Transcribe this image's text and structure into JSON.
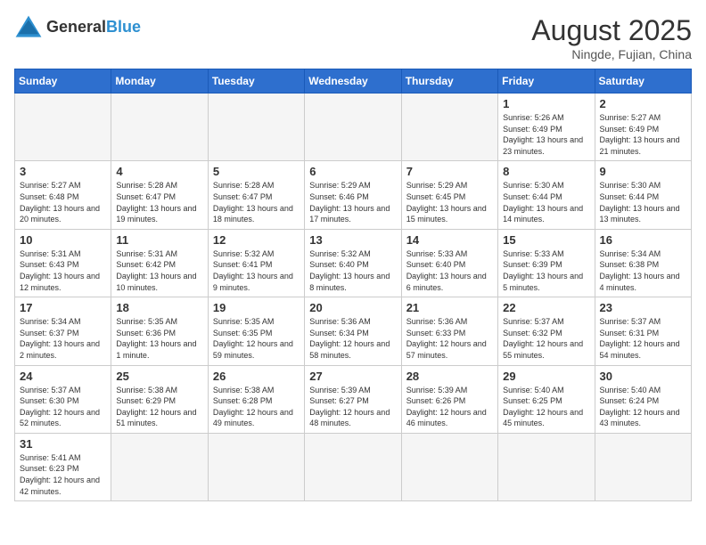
{
  "logo": {
    "text_general": "General",
    "text_blue": "Blue"
  },
  "title": "August 2025",
  "location": "Ningde, Fujian, China",
  "days_of_week": [
    "Sunday",
    "Monday",
    "Tuesday",
    "Wednesday",
    "Thursday",
    "Friday",
    "Saturday"
  ],
  "weeks": [
    [
      {
        "day": "",
        "info": ""
      },
      {
        "day": "",
        "info": ""
      },
      {
        "day": "",
        "info": ""
      },
      {
        "day": "",
        "info": ""
      },
      {
        "day": "",
        "info": ""
      },
      {
        "day": "1",
        "info": "Sunrise: 5:26 AM\nSunset: 6:49 PM\nDaylight: 13 hours and 23 minutes."
      },
      {
        "day": "2",
        "info": "Sunrise: 5:27 AM\nSunset: 6:49 PM\nDaylight: 13 hours and 21 minutes."
      }
    ],
    [
      {
        "day": "3",
        "info": "Sunrise: 5:27 AM\nSunset: 6:48 PM\nDaylight: 13 hours and 20 minutes."
      },
      {
        "day": "4",
        "info": "Sunrise: 5:28 AM\nSunset: 6:47 PM\nDaylight: 13 hours and 19 minutes."
      },
      {
        "day": "5",
        "info": "Sunrise: 5:28 AM\nSunset: 6:47 PM\nDaylight: 13 hours and 18 minutes."
      },
      {
        "day": "6",
        "info": "Sunrise: 5:29 AM\nSunset: 6:46 PM\nDaylight: 13 hours and 17 minutes."
      },
      {
        "day": "7",
        "info": "Sunrise: 5:29 AM\nSunset: 6:45 PM\nDaylight: 13 hours and 15 minutes."
      },
      {
        "day": "8",
        "info": "Sunrise: 5:30 AM\nSunset: 6:44 PM\nDaylight: 13 hours and 14 minutes."
      },
      {
        "day": "9",
        "info": "Sunrise: 5:30 AM\nSunset: 6:44 PM\nDaylight: 13 hours and 13 minutes."
      }
    ],
    [
      {
        "day": "10",
        "info": "Sunrise: 5:31 AM\nSunset: 6:43 PM\nDaylight: 13 hours and 12 minutes."
      },
      {
        "day": "11",
        "info": "Sunrise: 5:31 AM\nSunset: 6:42 PM\nDaylight: 13 hours and 10 minutes."
      },
      {
        "day": "12",
        "info": "Sunrise: 5:32 AM\nSunset: 6:41 PM\nDaylight: 13 hours and 9 minutes."
      },
      {
        "day": "13",
        "info": "Sunrise: 5:32 AM\nSunset: 6:40 PM\nDaylight: 13 hours and 8 minutes."
      },
      {
        "day": "14",
        "info": "Sunrise: 5:33 AM\nSunset: 6:40 PM\nDaylight: 13 hours and 6 minutes."
      },
      {
        "day": "15",
        "info": "Sunrise: 5:33 AM\nSunset: 6:39 PM\nDaylight: 13 hours and 5 minutes."
      },
      {
        "day": "16",
        "info": "Sunrise: 5:34 AM\nSunset: 6:38 PM\nDaylight: 13 hours and 4 minutes."
      }
    ],
    [
      {
        "day": "17",
        "info": "Sunrise: 5:34 AM\nSunset: 6:37 PM\nDaylight: 13 hours and 2 minutes."
      },
      {
        "day": "18",
        "info": "Sunrise: 5:35 AM\nSunset: 6:36 PM\nDaylight: 13 hours and 1 minute."
      },
      {
        "day": "19",
        "info": "Sunrise: 5:35 AM\nSunset: 6:35 PM\nDaylight: 12 hours and 59 minutes."
      },
      {
        "day": "20",
        "info": "Sunrise: 5:36 AM\nSunset: 6:34 PM\nDaylight: 12 hours and 58 minutes."
      },
      {
        "day": "21",
        "info": "Sunrise: 5:36 AM\nSunset: 6:33 PM\nDaylight: 12 hours and 57 minutes."
      },
      {
        "day": "22",
        "info": "Sunrise: 5:37 AM\nSunset: 6:32 PM\nDaylight: 12 hours and 55 minutes."
      },
      {
        "day": "23",
        "info": "Sunrise: 5:37 AM\nSunset: 6:31 PM\nDaylight: 12 hours and 54 minutes."
      }
    ],
    [
      {
        "day": "24",
        "info": "Sunrise: 5:37 AM\nSunset: 6:30 PM\nDaylight: 12 hours and 52 minutes."
      },
      {
        "day": "25",
        "info": "Sunrise: 5:38 AM\nSunset: 6:29 PM\nDaylight: 12 hours and 51 minutes."
      },
      {
        "day": "26",
        "info": "Sunrise: 5:38 AM\nSunset: 6:28 PM\nDaylight: 12 hours and 49 minutes."
      },
      {
        "day": "27",
        "info": "Sunrise: 5:39 AM\nSunset: 6:27 PM\nDaylight: 12 hours and 48 minutes."
      },
      {
        "day": "28",
        "info": "Sunrise: 5:39 AM\nSunset: 6:26 PM\nDaylight: 12 hours and 46 minutes."
      },
      {
        "day": "29",
        "info": "Sunrise: 5:40 AM\nSunset: 6:25 PM\nDaylight: 12 hours and 45 minutes."
      },
      {
        "day": "30",
        "info": "Sunrise: 5:40 AM\nSunset: 6:24 PM\nDaylight: 12 hours and 43 minutes."
      }
    ],
    [
      {
        "day": "31",
        "info": "Sunrise: 5:41 AM\nSunset: 6:23 PM\nDaylight: 12 hours and 42 minutes."
      },
      {
        "day": "",
        "info": ""
      },
      {
        "day": "",
        "info": ""
      },
      {
        "day": "",
        "info": ""
      },
      {
        "day": "",
        "info": ""
      },
      {
        "day": "",
        "info": ""
      },
      {
        "day": "",
        "info": ""
      }
    ]
  ]
}
